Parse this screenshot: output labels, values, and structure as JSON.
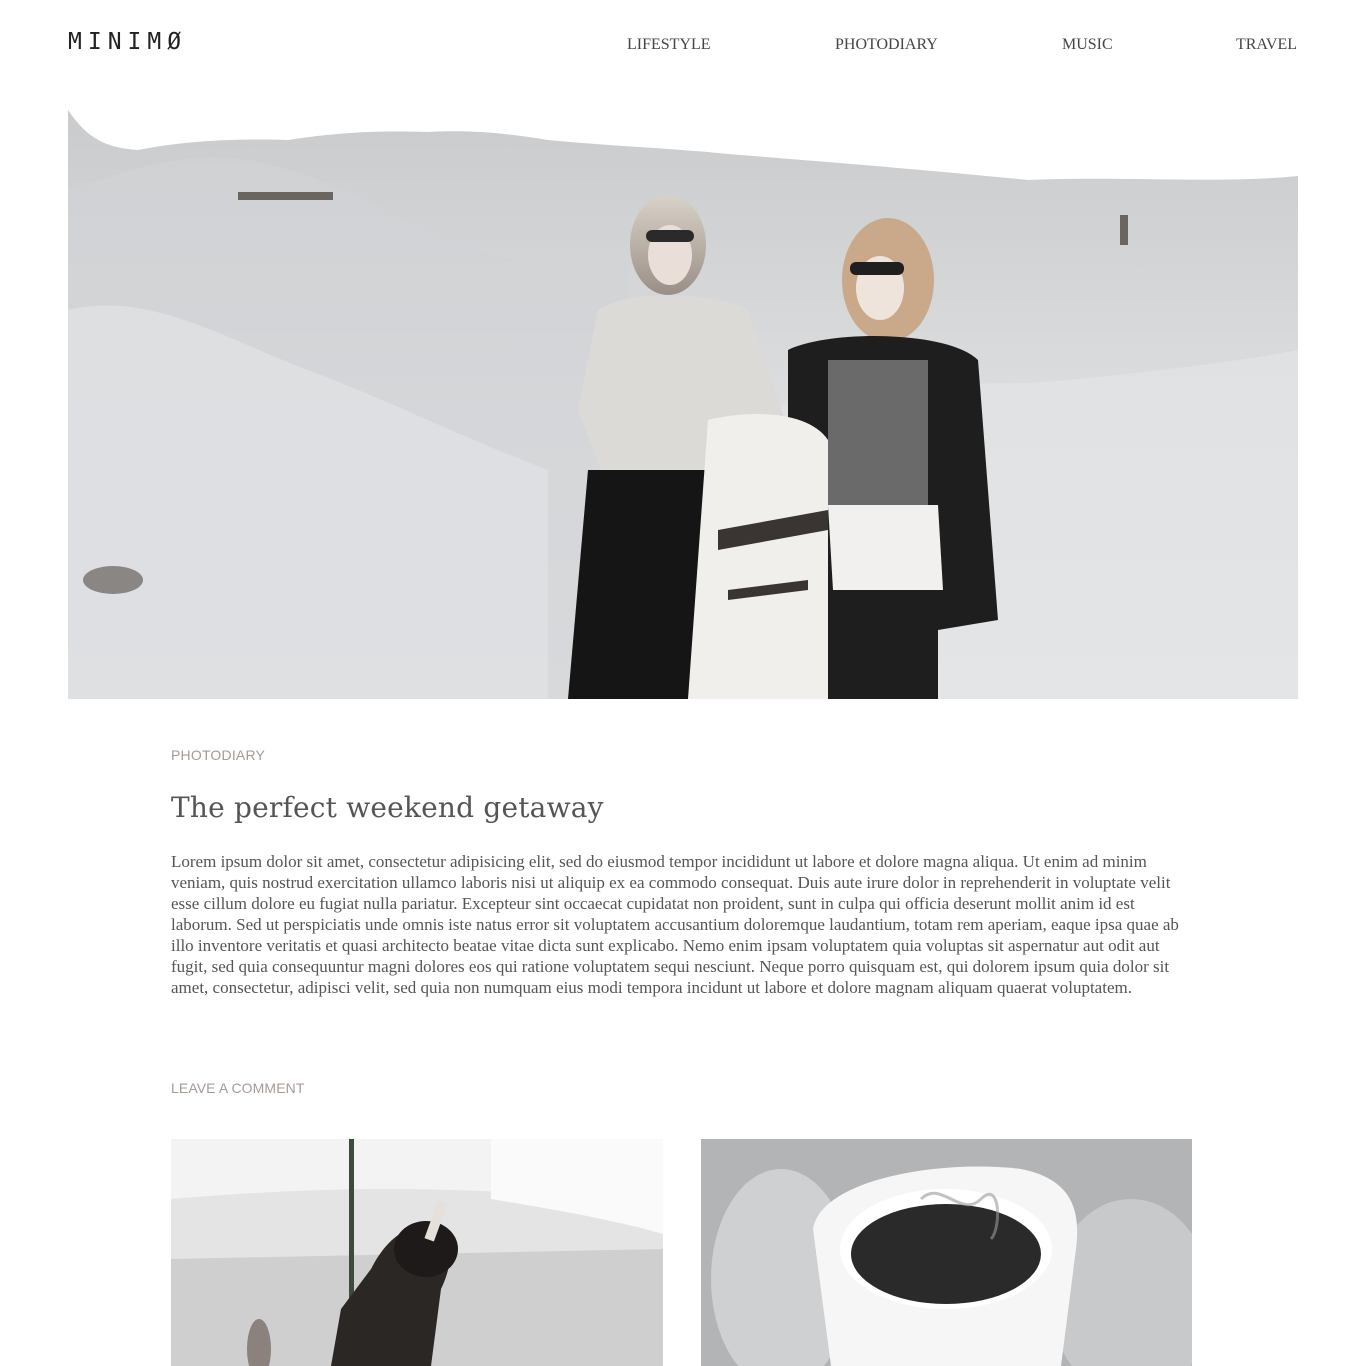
{
  "site": {
    "logo": "MINIMØ"
  },
  "nav": {
    "items": [
      {
        "label": "LIFESTYLE"
      },
      {
        "label": "PHOTODIARY"
      },
      {
        "label": "MUSIC"
      },
      {
        "label": "TRAVEL"
      }
    ]
  },
  "post": {
    "category": "PHOTODIARY",
    "title": "The perfect weekend getaway",
    "body": "Lorem ipsum dolor sit amet, consectetur adipisicing elit, sed do eiusmod tempor incididunt ut labore et dolore magna aliqua. Ut enim ad minim veniam, quis nostrud exercitation ullamco laboris nisi ut aliquip ex ea commodo consequat. Duis aute irure dolor in reprehenderit in voluptate velit esse cillum dolore eu fugiat nulla pariatur. Excepteur sint occaecat cupidatat non proident, sunt in culpa qui officia deserunt mollit anim id est laborum. Sed ut perspiciatis unde omnis iste natus error sit voluptatem accusantium doloremque laudantium, totam rem aperiam, eaque ipsa quae ab illo inventore veritatis et quasi architecto beatae vitae dicta sunt explicabo. Nemo enim ipsam voluptatem quia voluptas sit aspernatur aut odit aut fugit, sed quia consequuntur magni dolores eos qui ratione voluptatem sequi nesciunt. Neque porro quisquam est, qui dolorem ipsum quia dolor sit amet, consectetur, adipisci velit, sed quia non numquam eius modi tempora incidunt ut labore et dolore magnam aliquam quaerat voluptatem.",
    "comment_link": "LEAVE A COMMENT"
  },
  "colors": {
    "text": "#555555",
    "muted_label": "#a49b94",
    "logo": "#222222",
    "background": "#ffffff"
  },
  "images": {
    "hero": "hero-photo-two-women-desert",
    "thumb_left": "thumbnail-woman-dancing",
    "thumb_right": "thumbnail-coffee-cup-mittens"
  }
}
